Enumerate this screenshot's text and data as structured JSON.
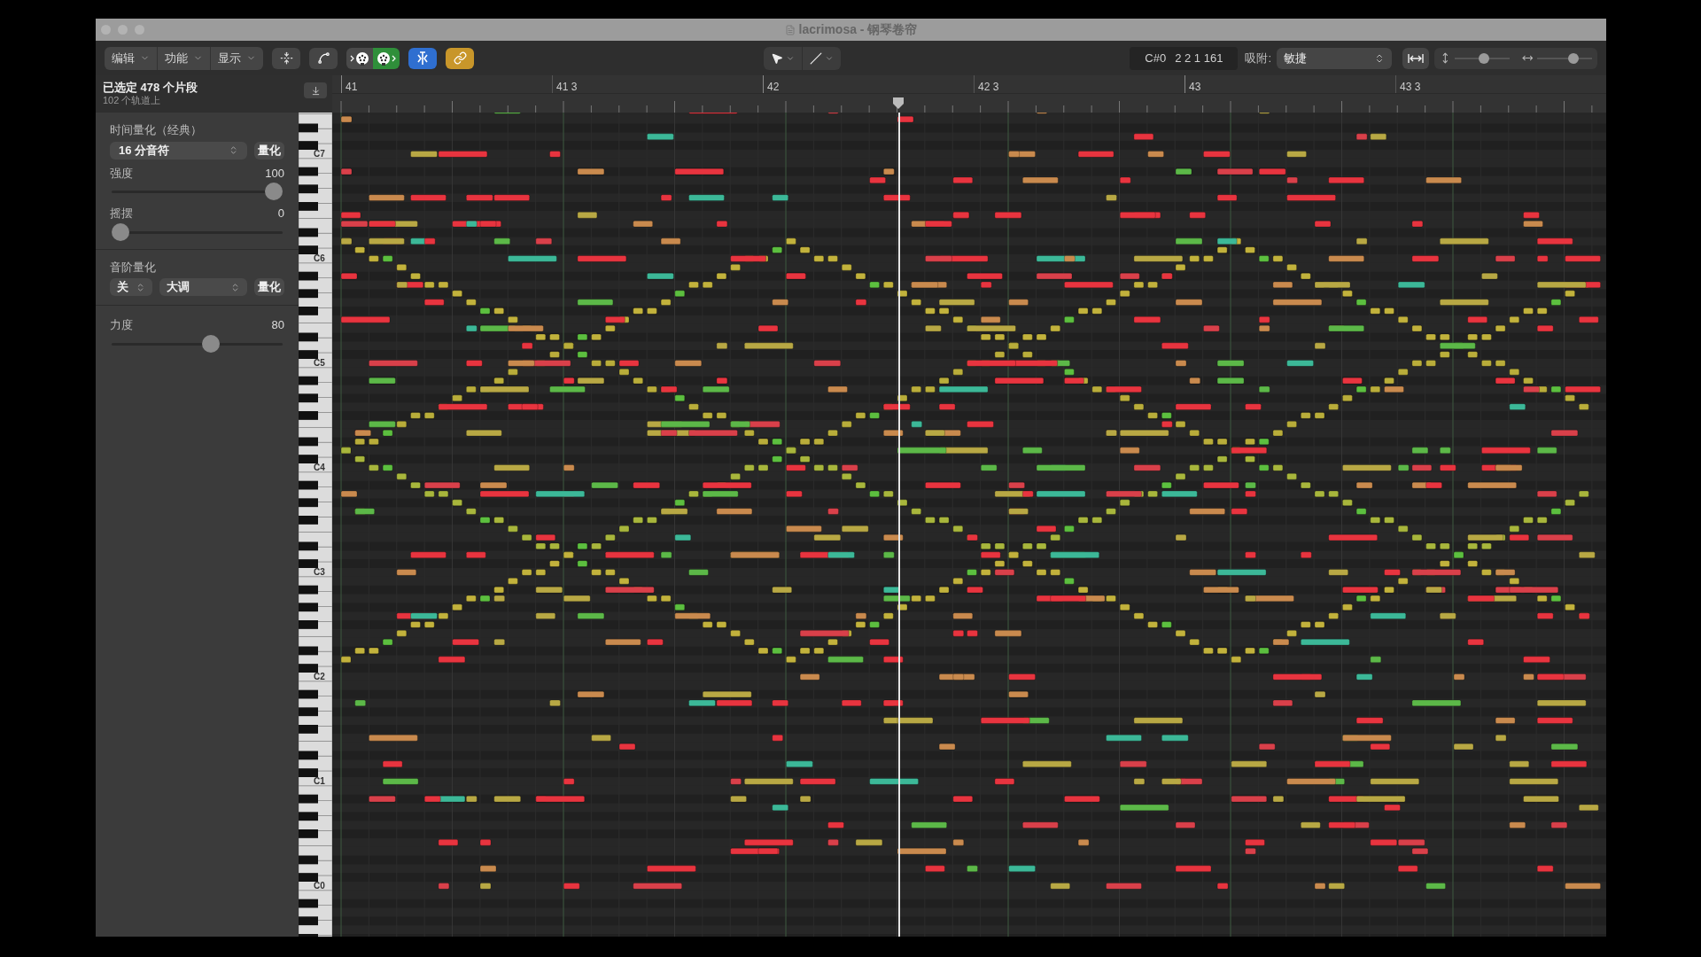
{
  "window": {
    "title": "lacrimosa - 钢琴卷帘"
  },
  "toolbar": {
    "menus": [
      {
        "label": "编辑"
      },
      {
        "label": "功能"
      },
      {
        "label": "显示"
      }
    ],
    "toggles": [
      {
        "kind": "midi-in",
        "on": false
      },
      {
        "kind": "midi-out",
        "on": true
      },
      {
        "kind": "catch",
        "on": true
      },
      {
        "kind": "link",
        "on": true
      }
    ],
    "position": {
      "pitch": "C#0",
      "time": "2 2 1 161"
    },
    "snap": {
      "label": "吸附:",
      "value": "敏捷"
    },
    "vertical_zoom": {
      "level": 0.55
    },
    "horizontal_zoom": {
      "level": 0.7
    }
  },
  "inspector": {
    "selection": "已选定 478 个片段",
    "subtitle": "102 个轨道上",
    "time_quantize": {
      "title": "时间量化（经典）",
      "value": "16 分音符",
      "button": "量化",
      "strength": {
        "label": "强度",
        "value": "100",
        "level": 1
      },
      "swing": {
        "label": "摇摆",
        "value": "0",
        "level": 0
      }
    },
    "scale_quantize": {
      "title": "音阶量化",
      "mode": "关",
      "scale": "大调",
      "button": "量化"
    },
    "velocity": {
      "label": "力度",
      "value": "80",
      "level": 0.59
    }
  },
  "ruler": {
    "labels": [
      "41",
      "41 3",
      "42",
      "42 3",
      "43",
      "43 3"
    ]
  },
  "keyboard": {
    "octave_labels": [
      "C7",
      "C6",
      "C5",
      "C4",
      "C3",
      "C2",
      "C1",
      "C0"
    ]
  }
}
